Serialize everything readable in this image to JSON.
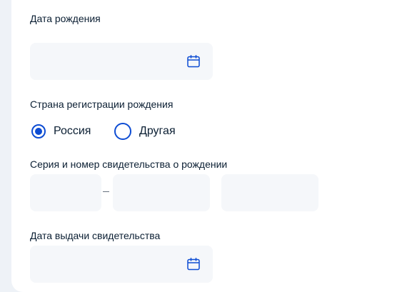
{
  "form": {
    "birth_date": {
      "label": "Дата рождения",
      "value": "",
      "icon": "calendar-icon"
    },
    "registration_country": {
      "label": "Страна регистрации рождения",
      "options": [
        {
          "label": "Россия",
          "selected": true
        },
        {
          "label": "Другая",
          "selected": false
        }
      ]
    },
    "certificate_number": {
      "label": "Серия и номер свидетельства о рождении",
      "parts": [
        "",
        "",
        ""
      ]
    },
    "issue_date": {
      "label": "Дата выдачи свидетельства",
      "value": "",
      "icon": "calendar-icon"
    }
  },
  "colors": {
    "accent": "#0d4cd3",
    "field_bg": "#f5f7fa",
    "text": "#0b1f33",
    "page_bg": "#eef2f7"
  }
}
